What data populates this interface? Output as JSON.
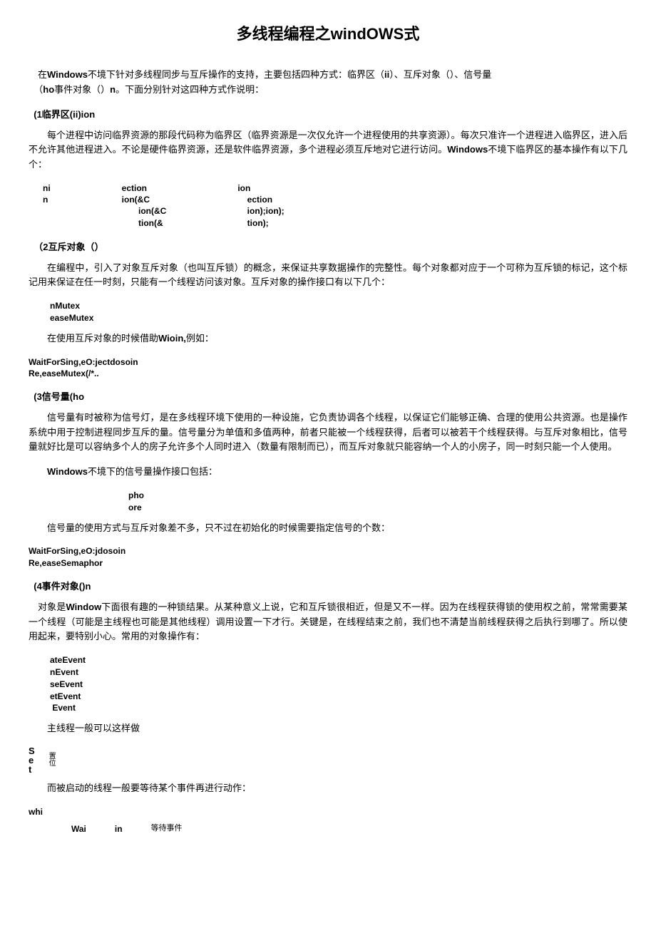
{
  "title": "多线程编程之windOWS式",
  "intro_p1a": "在",
  "intro_p1b": "Windows",
  "intro_p1c": "不境下针对多线程同步与互斥操作的支持，主要包括四种方式：临界区（",
  "intro_p1d": "ii",
  "intro_p1e": "）、互斥对象（）、信号量",
  "intro_p2a": "（",
  "intro_p2b": "ho",
  "intro_p2c": "事件对象（）",
  "intro_p2d": "n",
  "intro_p2e": "。下面分别针对这四种方式作说明：",
  "s1": {
    "title": "(1临界区(ii)ion",
    "p1": "每个进程中访问临界资源的那段代码称为临界区（临界资源是一次仅允许一个进程使用的共享资源）。每次只准许一个进程进入临界区，进入后不允许其他进程进入。不论是硬件临界资源，还是软件临界资源，多个进程必须互斥地对它进行访问。",
    "p1_bold": "Windows",
    "p1_tail": "不境下临界区的基本操作有以下几个：",
    "frag_c1": "ni\nn",
    "frag_c2": "ection\nion(&C\n       ion(&C\n       tion(&",
    "frag_c3": "ion\n    ection\n    ion);ion);\n    tion);"
  },
  "s2": {
    "title": "（2互斥对象（）",
    "p1": "在编程中，引入了对象互斥对象（也叫互斥锁）的概念，来保证共享数据操作的完整性。每个对象都对应于一个可称为互斥锁的标记，这个标记用来保证在任一时刻，只能有一个线程访问该对象。互斥对象的操作接口有以下几个：",
    "code1": "nMutex\neaseMutex",
    "mid1a": "在使用互斥对象的时候借助",
    "mid1b": "Wioin,",
    "mid1c": "例如：",
    "code2": "WaitForSing,eO:jectdosoin\nRe,easeMutex(/*.."
  },
  "s3": {
    "title": "(3信号量(ho",
    "p1": "信号量有时被称为信号灯，是在多线程环境下使用的一种设施，它负责协调各个线程，以保证它们能够正确、合理的使用公共资源。也是操作系统中用于控制进程同步互斥的量。信号量分为单值和多值两种，前者只能被一个线程获得，后者可以被若干个线程获得。与互斥对象相比，信号量就好比是可以容纳多个人的房子允许多个人同时进入（数量有限制而已），而互斥对象就只能容纳一个人的小房子，同一时刻只能一个人使用。",
    "mid_bold": "Windows",
    "mid_tail": "不境下的信号量操作接口包括：",
    "code1": "pho\nore",
    "mid2": "信号量的使用方式与互斥对象差不多，只不过在初始化的时候需要指定信号的个数：",
    "code2": "WaitForSing,eO:jdosoin\nRe,easeSemaphor"
  },
  "s4": {
    "title": "(4事件对象()n",
    "p1a": "对象是",
    "p1b": "Window",
    "p1c": "下面很有趣的一种锁结果。从某种意义上说，它和互斥锁很相近，但是又不一样。因为在线程获得锁的使用权之前，常常需要某一个线程（可能是主线程也可能是其他线程）调用设置一下才行。关键是，在线程结束之前，我们也不清楚当前线程获得之后执行到哪了。所以使用起来，要特别小心。常用的对象操作有：",
    "code1": "ateEvent\nnEvent\nseEvent\netEvent\n Event",
    "mid1": "主线程一般可以这样做",
    "set_big": "S\ne\nt",
    "set_small": "置\n位",
    "mid2": "而被启动的线程一般要等待某个事件再进行动作：",
    "w1": "whi",
    "w2": "Wai",
    "w3": "in",
    "w4": "等待事件"
  }
}
